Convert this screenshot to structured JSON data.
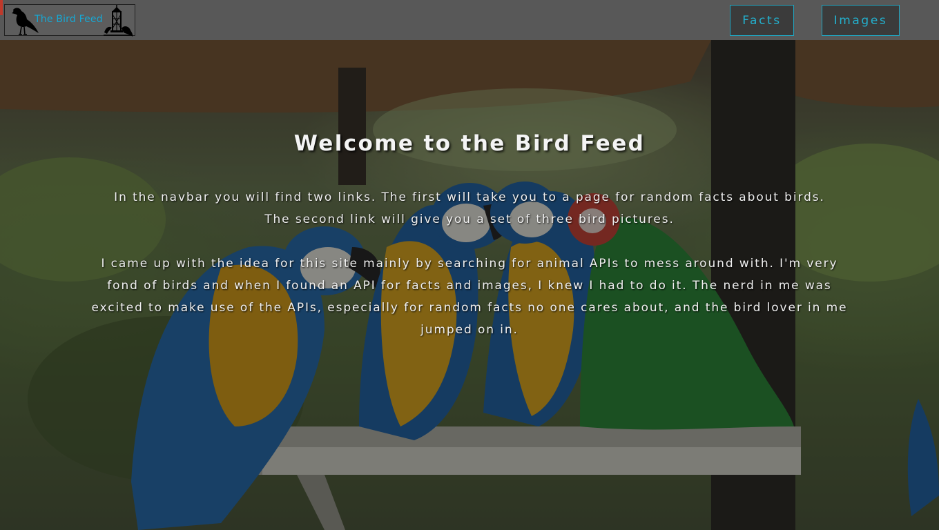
{
  "navbar": {
    "brand_text": "The Bird Feed",
    "links": [
      {
        "label": "Facts"
      },
      {
        "label": "Images"
      }
    ],
    "colors": {
      "bar": "#585858",
      "link": "#23b1cf",
      "brand_text": "#17a8d4"
    },
    "icons": [
      "crow-icon",
      "bird-feeder-icon"
    ]
  },
  "hero": {
    "title": "Welcome to the Bird Feed",
    "paragraph1": "In the navbar you will find two links. The first will take you to a page for random facts about birds.",
    "paragraph2": "The second link will give you a set of three bird pictures.",
    "paragraph3": "I came up with the idea for this site mainly by searching for animal APIs to mess around with. I'm very fond of birds and when I found an API for facts and images, I knew I had to do it. The nerd in me was excited to make use of the APIs, especially for random facts no one cares about, and the bird lover in me jumped on in.",
    "background": "macaw-parrots-photo"
  }
}
